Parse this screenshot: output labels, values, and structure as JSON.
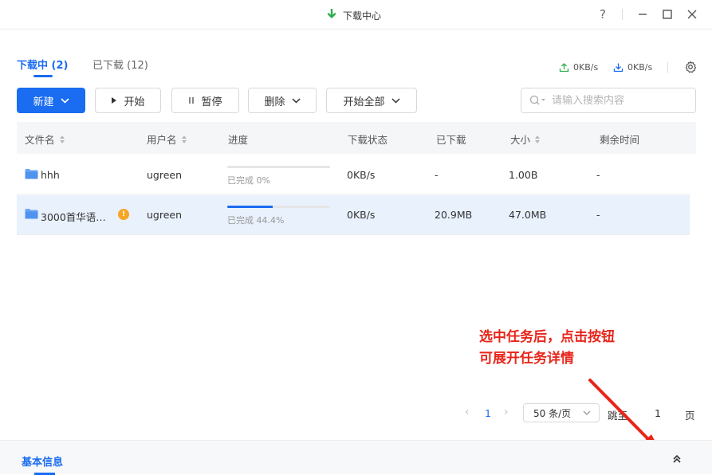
{
  "window": {
    "title": "下载中心",
    "help_label": "?"
  },
  "tabs": [
    {
      "label": "下载中 (2)",
      "active": true
    },
    {
      "label": "已下载 (12)",
      "active": false
    }
  ],
  "speeds": {
    "upload": "0KB/s",
    "download": "0KB/s"
  },
  "toolbar": {
    "new_label": "新建",
    "start_label": "开始",
    "pause_label": "暂停",
    "delete_label": "删除",
    "start_all_label": "开始全部",
    "search_placeholder": "请输入搜索内容"
  },
  "table": {
    "columns": [
      "文件名",
      "用户名",
      "进度",
      "下载状态",
      "已下载",
      "大小",
      "剩余时间"
    ],
    "rows": [
      {
        "name": "hhh",
        "user": "ugreen",
        "progress_text": "已完成 0%",
        "progress": 0,
        "status": "0KB/s",
        "downloaded": "-",
        "size": "1.00B",
        "remaining": "-",
        "warning": false,
        "selected": false
      },
      {
        "name": "3000首华语…",
        "user": "ugreen",
        "progress_text": "已完成 44.4%",
        "progress": 44.4,
        "status": "0KB/s",
        "downloaded": "20.9MB",
        "size": "47.0MB",
        "remaining": "-",
        "warning": true,
        "selected": true
      }
    ]
  },
  "pagination": {
    "current_page": "1",
    "page_size": "50 条/页",
    "jump_label": "跳至",
    "jump_value": "1",
    "page_suffix": "页"
  },
  "annotation": {
    "line1": "选中任务后，点击按钮",
    "line2": "可展开任务详情",
    "color": "#e8251b"
  },
  "details_panel": {
    "title": "基本信息"
  },
  "colors": {
    "accent": "#1a6cf0",
    "warning": "#f5a623",
    "selected_row": "#e9f1fd"
  }
}
